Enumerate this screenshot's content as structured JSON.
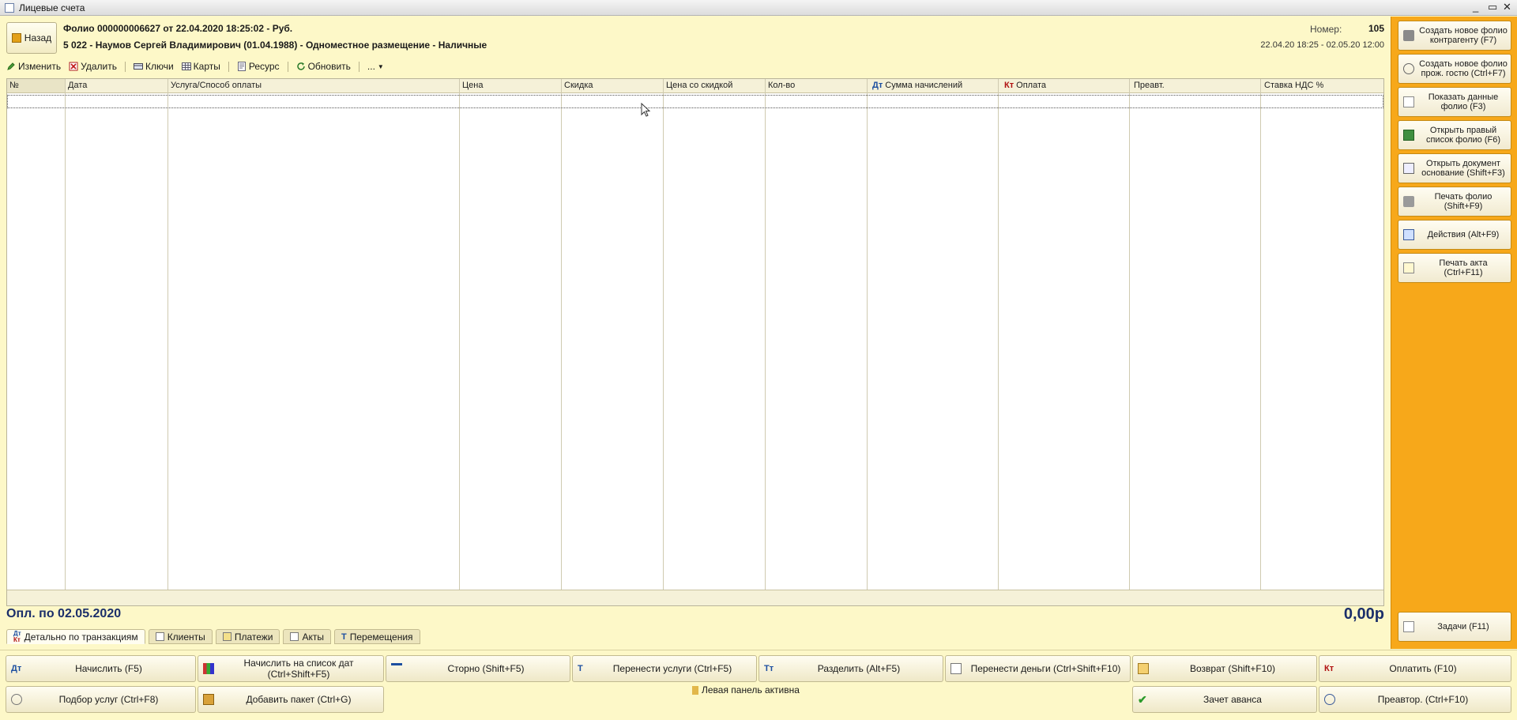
{
  "window": {
    "title": "Лицевые счета"
  },
  "header": {
    "back_label": "Назад",
    "folio_line": "Фолио 000000006627 от 22.04.2020 18:25:02 - Руб.",
    "guest_line": "5 022 - Наумов Сергей Владимирович (01.04.1988) - Одноместное размещение - Наличные",
    "number_label": "Номер:",
    "number_value": "105",
    "dates": "22.04.20 18:25 - 02.05.20 12:00"
  },
  "toolbar": {
    "edit": "Изменить",
    "delete": "Удалить",
    "keys": "Ключи",
    "cards": "Карты",
    "resource": "Ресурс",
    "refresh": "Обновить",
    "more": "..."
  },
  "grid": {
    "columns": [
      "№",
      "Дата",
      "Услуга/Способ оплаты",
      "Цена",
      "Скидка",
      "Цена со скидкой",
      "Кол-во",
      "Сумма начислений",
      "Оплата",
      "Преавт.",
      "Ставка НДС %"
    ],
    "dt_prefix": "Дт",
    "kt_prefix": "Кт"
  },
  "summary": {
    "paid_until": "Опл. по 02.05.2020",
    "total": "0,00р"
  },
  "tabs": [
    "Детально по транзакциям",
    "Клиенты",
    "Платежи",
    "Акты",
    "Перемещения"
  ],
  "sidebar": {
    "buttons": [
      "Создать новое фолио контрагенту (F7)",
      "Создать новое фолио прож. гостю (Ctrl+F7)",
      "Показать данные фолио (F3)",
      "Открыть правый список фолио (F6)",
      "Открыть документ основание (Shift+F3)",
      "Печать фолио (Shift+F9)",
      "Действия (Alt+F9)",
      "Печать акта (Ctrl+F11)"
    ],
    "tasks": "Задачи (F11)"
  },
  "actions": {
    "row1": [
      "Начислить (F5)",
      "Начислить на список дат (Ctrl+Shift+F5)",
      "Сторно (Shift+F5)",
      "Перенести услуги (Ctrl+F5)",
      "Разделить (Alt+F5)",
      "Перенести деньги (Ctrl+Shift+F10)",
      "Возврат (Shift+F10)",
      "Оплатить (F10)"
    ],
    "row2": {
      "pick": "Подбор услуг (Ctrl+F8)",
      "package": "Добавить пакет (Ctrl+G)",
      "status": "Левая панель активна",
      "advance": "Зачет аванса",
      "preauth": "Преавтор. (Ctrl+F10)"
    }
  },
  "colors": {
    "panel_bg": "#fdf8c8",
    "sidebar_bg": "#f7a81a",
    "total_text": "#1b2f6a",
    "debit": "#1d4fa0",
    "credit": "#b01010"
  }
}
